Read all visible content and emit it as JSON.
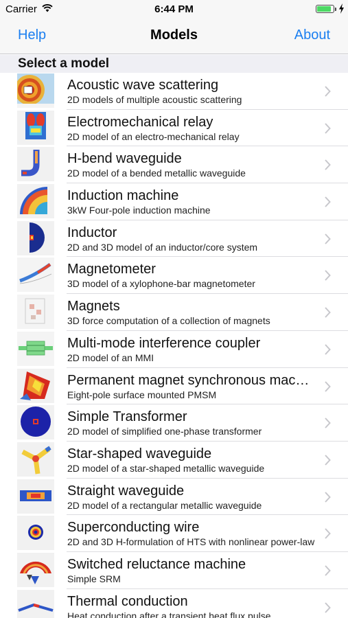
{
  "status_bar": {
    "carrier": "Carrier",
    "time": "6:44 PM",
    "battery_level": 0.85
  },
  "nav": {
    "left_label": "Help",
    "title": "Models",
    "right_label": "About"
  },
  "section_header": "Select a model",
  "models": [
    {
      "title": "Acoustic wave scattering",
      "subtitle": "2D models of multiple acoustic scattering",
      "icon": "acoustic-scattering-thumbnail"
    },
    {
      "title": "Electromechanical relay",
      "subtitle": "2D model of an electro-mechanical relay",
      "icon": "relay-thumbnail"
    },
    {
      "title": "H-bend waveguide",
      "subtitle": "2D model of a bended metallic waveguide",
      "icon": "h-bend-thumbnail"
    },
    {
      "title": "Induction machine",
      "subtitle": "3kW Four-pole induction machine",
      "icon": "induction-machine-thumbnail"
    },
    {
      "title": "Inductor",
      "subtitle": "2D and 3D model of an inductor/core system",
      "icon": "inductor-thumbnail"
    },
    {
      "title": "Magnetometer",
      "subtitle": "3D model of a xylophone-bar magnetometer",
      "icon": "magnetometer-thumbnail"
    },
    {
      "title": "Magnets",
      "subtitle": "3D force computation of a collection of magnets",
      "icon": "magnets-thumbnail"
    },
    {
      "title": "Multi-mode interference coupler",
      "subtitle": "2D model of an MMI",
      "icon": "mmi-thumbnail"
    },
    {
      "title": "Permanent magnet synchronous machine",
      "subtitle": "Eight-pole surface mounted PMSM",
      "icon": "pmsm-thumbnail"
    },
    {
      "title": "Simple Transformer",
      "subtitle": "2D model of simplified one-phase transformer",
      "icon": "transformer-thumbnail"
    },
    {
      "title": "Star-shaped waveguide",
      "subtitle": "2D model of a star-shaped metallic waveguide",
      "icon": "star-waveguide-thumbnail"
    },
    {
      "title": "Straight waveguide",
      "subtitle": "2D model of a rectangular metallic waveguide",
      "icon": "straight-waveguide-thumbnail"
    },
    {
      "title": "Superconducting wire",
      "subtitle": "2D and 3D H-formulation of HTS with nonlinear power-law",
      "icon": "superconducting-wire-thumbnail"
    },
    {
      "title": "Switched reluctance machine",
      "subtitle": "Simple SRM",
      "icon": "srm-thumbnail"
    },
    {
      "title": "Thermal conduction",
      "subtitle": "Heat conduction after a transient heat flux pulse",
      "icon": "thermal-conduction-thumbnail"
    }
  ],
  "colors": {
    "accent": "#1b7ff0",
    "battery": "#4cd964",
    "section_bg": "#efeff4"
  }
}
